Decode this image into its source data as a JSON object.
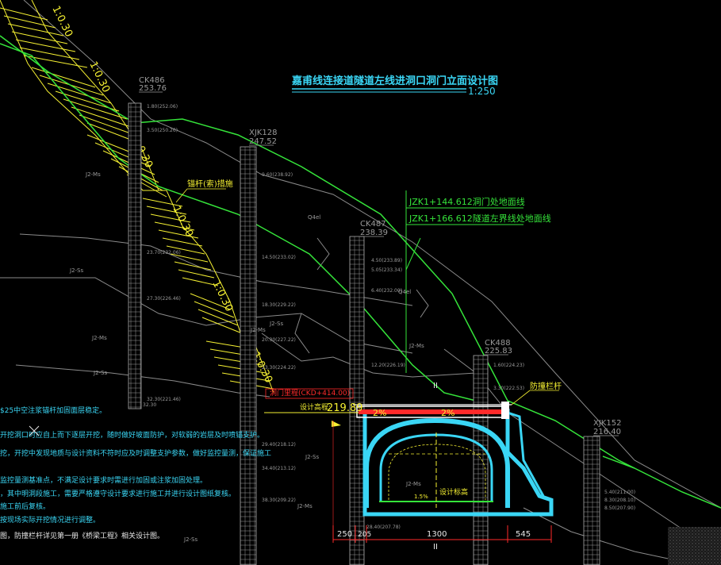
{
  "title": {
    "text": "嘉甫线连接道隧道左线进洞口洞门立面设计图",
    "scale": "1:250"
  },
  "slope_labels": [
    "1:0.30",
    "1:0.30",
    "1:0.30",
    "1:0.30",
    "1:0.30",
    "1:0.30"
  ],
  "boreholes": [
    {
      "id": "CK486",
      "elev": "253.76",
      "layers": [
        "1.80(252.06)",
        "3.50(250.26)",
        "23.70(232.06)",
        "27.30(226.46)",
        "32.30(221.46)",
        "32.30"
      ]
    },
    {
      "id": "XJK128",
      "elev": "247.52",
      "layers": [
        "9.60(238.92)",
        "14.50(233.02)",
        "18.30(229.22)",
        "20.30(227.22)",
        "23.30(224.22)",
        "29.40(218.12)",
        "34.40(213.12)",
        "38.30(209.22)"
      ]
    },
    {
      "id": "CK487",
      "elev": "238.39",
      "layers": [
        "4.50(233.89)",
        "5.05(233.34)",
        "6.40(232.00)",
        "12.20(226.19)",
        "28.40(207.78)"
      ]
    },
    {
      "id": "CK488",
      "elev": "225.83",
      "layers": [
        "1.60(224.23)",
        "3.30(222.53)"
      ]
    },
    {
      "id": "XJK152",
      "elev": "216.40",
      "layers": [
        "5.40(211.00)",
        "8.30(208.10)",
        "8.50(207.90)"
      ]
    }
  ],
  "stations": [
    "JZK1+144.612洞门处地面线",
    "JZK1+166.612隧道左界线处地面线"
  ],
  "annotations": {
    "anchor_support": "锚杆(索)措施",
    "guardrail": "防撞栏杆",
    "design_elev_label": "设计高程:",
    "design_elev_value": "219.89",
    "portal_station": "洞门里程(CKD+414.00)",
    "inner_design": "设计标高",
    "grade_left": "2%",
    "grade_right": "2%",
    "inner_grade": "1.5%",
    "rock_codes": [
      "J2-Ss",
      "J2-Ms",
      "Q4el",
      "Q4el",
      "J2-Ms",
      "J2-Ss",
      "J2-Ms",
      "J2-Ss",
      "J2-Ms",
      "J2-Ms",
      "J2-Ss",
      "J2-Ms",
      "J2-Ss"
    ],
    "section_mark": "II"
  },
  "dimensions": [
    "250",
    "205",
    "1300",
    "545"
  ],
  "notes": [
    "$25中空注浆锚杆加固面层稳定。",
    "开挖洞口时应自上而下逐层开挖，随时做好坡面防护，对软弱的岩层及时喷锚支护。",
    "挖，开挖中发现地质与设计资料不符时应及时调整支护参数，做好监控量测，保证施工",
    "监控量测基准点，不满足设计要求时需进行加固或注浆加固处理。",
    "，其中明洞段施工，需要严格遵守设计要求进行施工并进行设计图纸复核。",
    "施工前后复核。",
    "按现场实际开挖情况进行调整。",
    "图，防撞栏杆详见第一册《桥梁工程》相关设计图。"
  ],
  "colors": {
    "cyan": "#3ad6f5",
    "yellow": "#f5f032",
    "green": "#35e43a",
    "white": "#e8e8e8",
    "red": "#ff2a2a",
    "grey": "#9a9a9a"
  }
}
